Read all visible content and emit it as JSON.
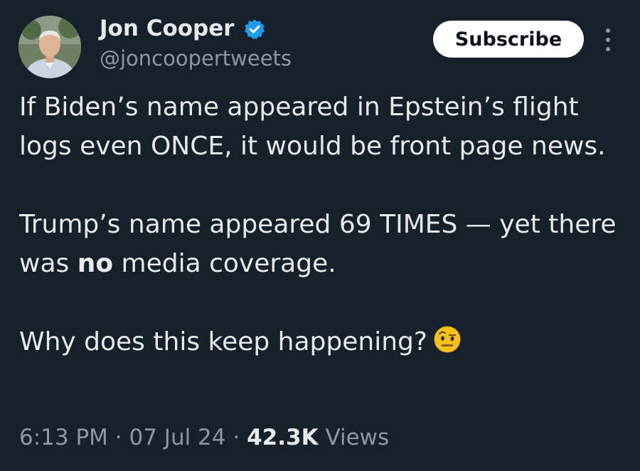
{
  "author": {
    "display_name": "Jon Cooper",
    "handle": "@joncoopertweets",
    "verified": true,
    "avatar_icon": "profile-photo"
  },
  "actions": {
    "subscribe_label": "Subscribe",
    "more_icon": "more-vertical-icon"
  },
  "tweet": {
    "line1_a": "If Biden’s name appeared in Epstein’s flight logs even ONCE, it would be front page news.",
    "line2_a": "Trump’s name appeared 69 TIMES — yet there was ",
    "line2_bold": "no",
    "line2_b": " media coverage.",
    "line3": "Why does this keep happening?",
    "emoji": "raised-eyebrow-face"
  },
  "meta": {
    "time": "6:13 PM",
    "separator": "·",
    "date": "07 Jul 24",
    "views_count": "42.3K",
    "views_label": "Views"
  },
  "colors": {
    "background": "#15202b",
    "text": "#e7e9ea",
    "secondary": "#8b98a5",
    "verified": "#1d9bf0"
  }
}
